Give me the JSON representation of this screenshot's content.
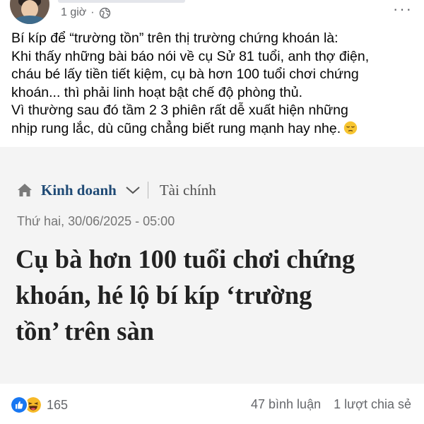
{
  "header": {
    "time": "1 giờ",
    "privacy_icon": "globe-icon",
    "more_icon": "more-dots-icon"
  },
  "post": {
    "lines": [
      "Bí kíp để “trường tồn” trên thị trường chứng khoán là:",
      "Khi thấy những bài báo nói về cụ Sử 81 tuổi, anh thợ điện,",
      "cháu bé lấy tiền tiết kiệm, cụ bà hơn 100 tuổi chơi chứng",
      "khoán... thì phải linh hoạt bật chế độ phòng thủ.",
      "Vì thường sau đó tầm 2 3 phiên rất dễ xuất hiện những",
      "nhịp rung lắc, dù cũng chẳng biết rung mạnh hay nhẹ."
    ],
    "trailing_emoji": "pensive-face-emoji"
  },
  "link_card": {
    "category": "Kinh doanh",
    "subcategory": "Tài chính",
    "date": "Thứ hai, 30/06/2025 - 05:00",
    "headline_lines": [
      "Cụ bà hơn 100 tuổi chơi chứng",
      "khoán, hé lộ bí kíp ‘trường",
      "tồn’ trên sàn"
    ]
  },
  "footer": {
    "reaction_count": "165",
    "comments": "47 bình luận",
    "shares": "1 lượt chia sẻ"
  },
  "colors": {
    "category_blue": "#1f4a75",
    "like_blue": "#1877f2",
    "haha_yellow": "#f7b928",
    "secondary_text": "#65676b"
  }
}
